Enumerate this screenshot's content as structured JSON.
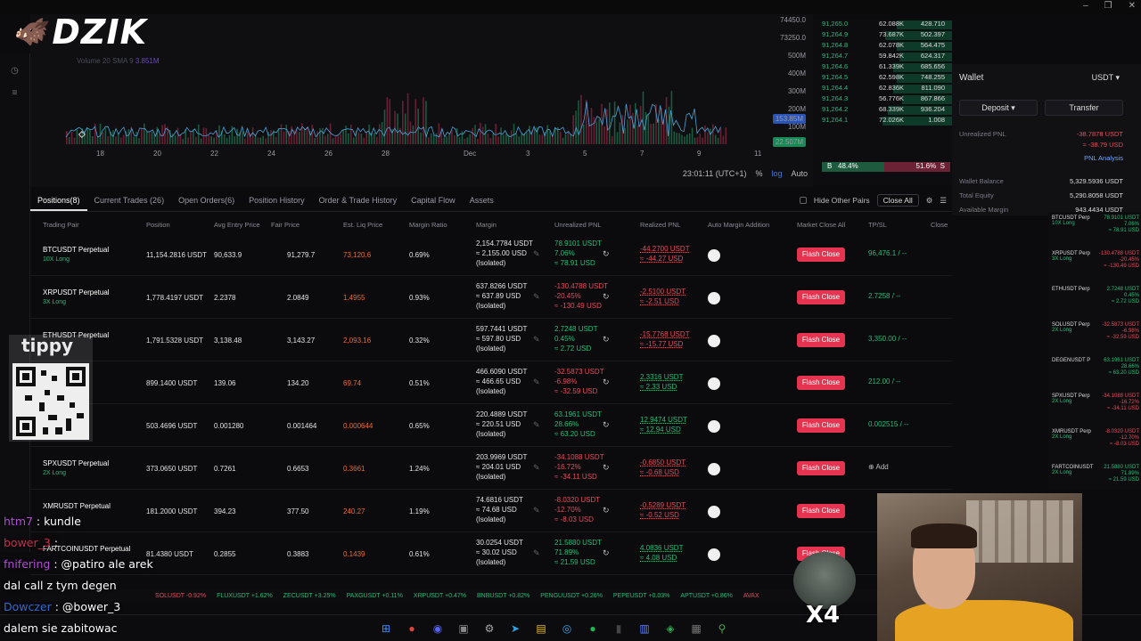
{
  "logo": {
    "text": "DZIK",
    "icon": "bull-icon"
  },
  "chart": {
    "volume_label": "Volume 20 SMA 9",
    "volume_value": "3.851M",
    "y_ticks": [
      "73250.0",
      "500M",
      "400M",
      "300M",
      "200M",
      "100M"
    ],
    "y_top": "74450.0",
    "tags": [
      {
        "text": "153.85M",
        "color": "#2a55b8"
      },
      {
        "text": "22.507M",
        "color": "#178a56"
      }
    ],
    "x_ticks": [
      "18",
      "20",
      "22",
      "24",
      "26",
      "28",
      "Dec",
      "3",
      "5",
      "7",
      "9",
      "11"
    ],
    "time": "23:01:11 (UTC+1)",
    "pct": "%",
    "log": "log",
    "auto": "Auto"
  },
  "orderbook": {
    "rows": [
      {
        "p": "91,265.0",
        "q": "62.088K",
        "t": "428.710"
      },
      {
        "p": "91,264.9",
        "q": "73.687K",
        "t": "502.397"
      },
      {
        "p": "91,264.8",
        "q": "62.078K",
        "t": "564.475"
      },
      {
        "p": "91,264.7",
        "q": "59.842K",
        "t": "624.317"
      },
      {
        "p": "91,264.6",
        "q": "61.339K",
        "t": "685.656"
      },
      {
        "p": "91,264.5",
        "q": "62.598K",
        "t": "748.255"
      },
      {
        "p": "91,264.4",
        "q": "62.836K",
        "t": "811.090"
      },
      {
        "p": "91,264.3",
        "q": "56.776K",
        "t": "867.866"
      },
      {
        "p": "91,264.2",
        "q": "68.339K",
        "t": "936.204"
      },
      {
        "p": "91,264.1",
        "q": "72.026K",
        "t": "1.008"
      }
    ],
    "buy_label": "B",
    "buy_pct": "48.4%",
    "sell_pct": "51.6%",
    "sell_label": "S"
  },
  "wallet": {
    "title": "Wallet",
    "currency": "USDT",
    "deposit": "Deposit",
    "transfer": "Transfer",
    "unrealized_label": "Unrealized PNL",
    "unrealized_1": "-38.7878 USDT",
    "unrealized_2": "≈ -38.79 USD",
    "pnl_analysis": "PNL Analysis",
    "balance_label": "Wallet Balance",
    "balance_val": "5,329.5936 USDT",
    "equity_label": "Total Equity",
    "equity_val": "5,290.8058 USDT",
    "avail_label": "Available Margin",
    "avail_val": "943.4434 USDT"
  },
  "tabs": [
    {
      "label": "Positions(8)",
      "active": true
    },
    {
      "label": "Current Trades (26)"
    },
    {
      "label": "Open Orders(6)"
    },
    {
      "label": "Position History"
    },
    {
      "label": "Order & Trade History"
    },
    {
      "label": "Capital Flow"
    },
    {
      "label": "Assets"
    }
  ],
  "tab_right": {
    "hide_other": "Hide Other Pairs",
    "close_all": "Close All"
  },
  "columns": [
    "Trading Pair",
    "Position",
    "Avg Entry Price",
    "Fair Price",
    "Est. Liq Price",
    "Margin Ratio",
    "Margin",
    "Unrealized PNL",
    "Realized PNL",
    "Auto Margin Addition",
    "Market Close All",
    "TP/SL",
    "Close"
  ],
  "positions": [
    {
      "name": "BTCUSDT  Perpetual",
      "lev": "10X Long",
      "position": "11,154.2816 USDT",
      "entry": "90,633.9",
      "fair": "91,279.7",
      "liq": "73,120.6",
      "ratio": "0.69%",
      "m1": "2,154.7784 USDT",
      "m2": "≈ 2,155.00 USD",
      "m3": "(Isolated)",
      "u1": "78.9101 USDT",
      "u2": "7.06%",
      "u3": "≈ 78.91 USD",
      "u_pos": true,
      "r1": "-44.2700 USDT",
      "r2": "≈ -44.27 USD",
      "tpsl": "96,476.1 / --",
      "flash": "Flash Close"
    },
    {
      "name": "XRPUSDT  Perpetual",
      "lev": "3X Long",
      "position": "1,778.4197 USDT",
      "entry": "2.2378",
      "fair": "2.0849",
      "liq": "1.4955",
      "ratio": "0.93%",
      "m1": "637.8266 USDT",
      "m2": "≈ 637.89 USD",
      "m3": "(Isolated)",
      "u1": "-130.4788 USDT",
      "u2": "-20.45%",
      "u3": "≈ -130.49 USD",
      "u_pos": false,
      "r1": "-2.5100 USDT",
      "r2": "≈ -2.51 USD",
      "tpsl": "2.7258 / --",
      "flash": "Flash Close"
    },
    {
      "name": "ETHUSDT  Perpetual",
      "lev": "",
      "position": "1,791.5328 USDT",
      "entry": "3,138.48",
      "fair": "3,143.27",
      "liq": "2,093.16",
      "ratio": "0.32%",
      "m1": "597.7441 USDT",
      "m2": "≈ 597.80 USD",
      "m3": "(Isolated)",
      "u1": "2.7248 USDT",
      "u2": "0.45%",
      "u3": "≈ 2.72 USD",
      "u_pos": true,
      "r1": "-15.7768 USDT",
      "r2": "≈ -15.77 USD",
      "tpsl": "3,350.00 / --",
      "flash": "Flash Close"
    },
    {
      "name": "",
      "lev": "",
      "position": "899.1400 USDT",
      "entry": "139.06",
      "fair": "134.20",
      "liq": "69.74",
      "ratio": "0.51%",
      "m1": "466.6090 USDT",
      "m2": "≈ 466.65 USD",
      "m3": "(Isolated)",
      "u1": "-32.5873 USDT",
      "u2": "-6.98%",
      "u3": "≈ -32.59 USD",
      "u_pos": false,
      "r1": "2.3316 USDT",
      "r2": "≈ 2.33 USD",
      "tpsl": "212.00 / --",
      "flash": "Flash Close"
    },
    {
      "name": "Perpetual",
      "lev": "",
      "position": "503.4696 USDT",
      "entry": "0.001280",
      "fair": "0.001464",
      "liq": "0.000644",
      "ratio": "0.65%",
      "m1": "220.4889 USDT",
      "m2": "≈ 220.51 USD",
      "m3": "(Isolated)",
      "u1": "63.1961 USDT",
      "u2": "28.66%",
      "u3": "≈ 63.20 USD",
      "u_pos": true,
      "r1": "12.9474 USDT",
      "r2": "≈ 12.94 USD",
      "tpsl": "0.002515 / --",
      "flash": "Flash Close"
    },
    {
      "name": "SPXUSDT  Perpetual",
      "lev": "2X Long",
      "position": "373.0650 USDT",
      "entry": "0.7261",
      "fair": "0.6653",
      "liq": "0.3661",
      "ratio": "1.24%",
      "m1": "203.9969 USDT",
      "m2": "≈ 204.01 USD",
      "m3": "(Isolated)",
      "u1": "-34.1088 USDT",
      "u2": "-16.72%",
      "u3": "≈ -34.11 USD",
      "u_pos": false,
      "r1": "-0.6850 USDT",
      "r2": "≈ -0.68 USD",
      "tpsl": "Add",
      "flash": "Flash Close"
    },
    {
      "name": "XMRUSDT  Perpetual",
      "lev": "",
      "position": "181.2000 USDT",
      "entry": "394.23",
      "fair": "377.50",
      "liq": "240.27",
      "ratio": "1.19%",
      "m1": "74.6816 USDT",
      "m2": "≈ 74.68 USD",
      "m3": "(Isolated)",
      "u1": "-8.0320 USDT",
      "u2": "-12.70%",
      "u3": "≈ -8.03 USD",
      "u_pos": false,
      "r1": "-0.5289 USDT",
      "r2": "≈ -0.52 USD",
      "tpsl": "",
      "flash": "Flash Close"
    },
    {
      "name": "FARTCOINUSDT  Perpetual",
      "lev": "",
      "position": "81.4380 USDT",
      "entry": "0.2855",
      "fair": "0.3883",
      "liq": "0.1439",
      "ratio": "0.61%",
      "m1": "30.0254 USDT",
      "m2": "≈ 30.02 USD",
      "m3": "(Isolated)",
      "u1": "21.5880 USDT",
      "u2": "71.89%",
      "u3": "≈ 21.59 USD",
      "u_pos": true,
      "r1": "4.0836 USDT",
      "r2": "≈ 4.08 USD",
      "tpsl": "",
      "flash": "Flash Close"
    }
  ],
  "ticker": [
    {
      "t": "SOLUSDT -0.92%",
      "pos": false
    },
    {
      "t": "FLUXUSDT +1.62%",
      "pos": true
    },
    {
      "t": "ZECUSDT +3.25%",
      "pos": true
    },
    {
      "t": "PAXGUSDT +0.11%",
      "pos": true
    },
    {
      "t": "XRPUSDT +0.47%",
      "pos": true
    },
    {
      "t": "BNBUSDT +0.82%",
      "pos": true
    },
    {
      "t": "PENGUUSDT +0.26%",
      "pos": true
    },
    {
      "t": "PEPEUSDT +0.03%",
      "pos": true
    },
    {
      "t": "APTUSDT +0.86%",
      "pos": true
    },
    {
      "t": "AVAX",
      "pos": false
    }
  ],
  "mini_panel": [
    {
      "n": "BTCUSDT Perp",
      "l": "10X Long",
      "v": [
        "78.9101 USDT",
        "7.06%",
        "≈ 78.91 USD"
      ],
      "pos": true
    },
    {
      "n": "XRPUSDT Perp",
      "l": "3X Long",
      "v": [
        "-130.4788 USDT",
        "-20.45%",
        "≈ -130.49 USD"
      ],
      "pos": false
    },
    {
      "n": "ETHUSDT Perp",
      "l": "",
      "v": [
        "2.7248 USDT",
        "0.45%",
        "≈ 2.72 USD"
      ],
      "pos": true
    },
    {
      "n": "SOLUSDT Perp",
      "l": "2X Long",
      "v": [
        "-32.5873 USDT",
        "-6.98%",
        "≈ -32.59 USD"
      ],
      "pos": false
    },
    {
      "n": "DEGENUSDT P",
      "l": "",
      "v": [
        "63.1961 USDT",
        "28.66%",
        "≈ 63.20 USD"
      ],
      "pos": true
    },
    {
      "n": "SPXUSDT Perp",
      "l": "2X Long",
      "v": [
        "-34.1088 USDT",
        "-16.72%",
        "≈ -34.11 USD"
      ],
      "pos": false
    },
    {
      "n": "XMRUSDT Perp",
      "l": "2X Long",
      "v": [
        "-8.0320 USDT",
        "-12.70%",
        "≈ -8.03 USD"
      ],
      "pos": false
    },
    {
      "n": "FARTCOINUSDT",
      "l": "2X Long",
      "v": [
        "21.5880 USDT",
        "71.89%",
        "≈ 21.59 USD"
      ],
      "pos": true
    }
  ],
  "tippy": {
    "label": "tippy"
  },
  "chat": [
    {
      "user": "htm7",
      "msg": " : kundle",
      "cls": "user"
    },
    {
      "user": "bower_3",
      "msg": " : ",
      "cls": "user2"
    },
    {
      "user": "fnifering",
      "msg": " : @patiro ale arek",
      "cls": "user"
    },
    {
      "user": "",
      "msg": "dal call z tym degen",
      "cls": ""
    },
    {
      "user": "Dowczer",
      "msg": " : @bower_3",
      "cls": "user3"
    },
    {
      "user": "",
      "msg": "dalem sie zabitowac",
      "cls": ""
    }
  ],
  "x4": "X4",
  "taskbar_icons": [
    "windows-icon",
    "chrome-icon",
    "discord-icon",
    "app-icon",
    "settings-icon",
    "telegram-icon",
    "folder-icon",
    "browser-icon",
    "spotify-icon",
    "terminal-icon",
    "notes-icon",
    "shield-icon",
    "calc-icon",
    "pin-icon"
  ]
}
